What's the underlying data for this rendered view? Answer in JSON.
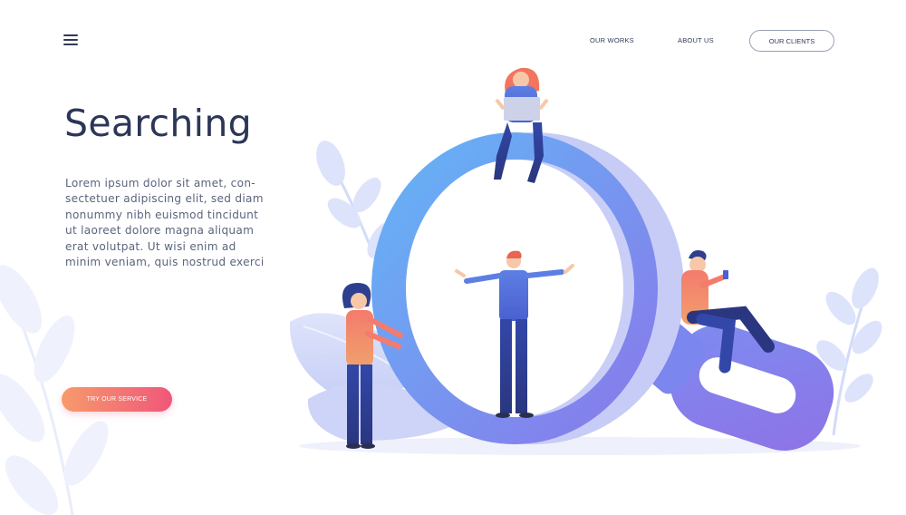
{
  "nav": {
    "menu_icon": "hamburger-menu-icon",
    "links": [
      {
        "label": "OUR WORKS"
      },
      {
        "label": "ABOUT US"
      },
      {
        "label": "OUR CLIENTS"
      }
    ]
  },
  "hero": {
    "title": "Searching",
    "body": "Lorem ipsum dolor sit amet, con-\nsectetuer adipiscing elit, sed diam\nnonummy nibh euismod tincidunt\nut laoreet dolore magna aliquam\nerat volutpat. Ut wisi enim ad\nminim veniam, quis nostrud exerci",
    "cta_label": "TRY OUR SERVICE"
  },
  "colors": {
    "accent_gradient_start": "#f79a6b",
    "accent_gradient_end": "#f0577a",
    "text_dark": "#2c3656",
    "magnifier_blue": "#6ea3f5",
    "magnifier_purple": "#8377ea"
  }
}
